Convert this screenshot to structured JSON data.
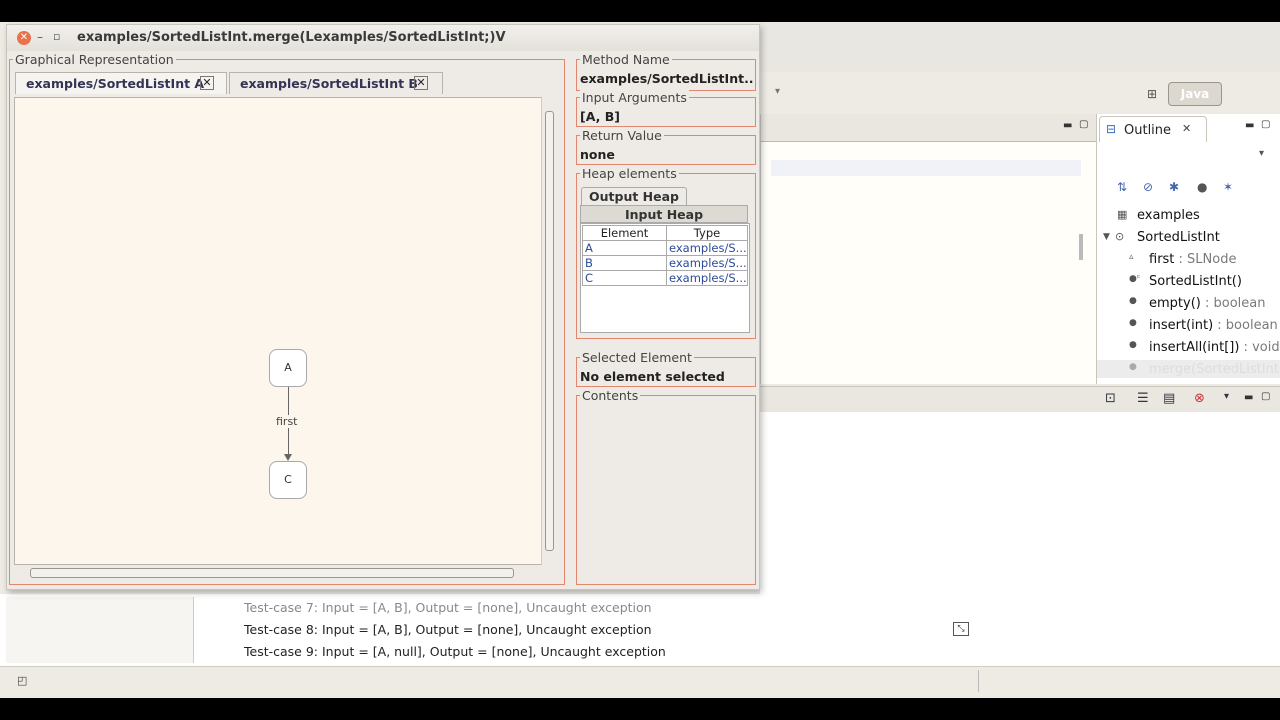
{
  "dialog": {
    "title": "examples/SortedListInt.merge(Lexamples/SortedListInt;)V",
    "graphical_label": "Graphical Representation",
    "tabs": [
      {
        "label": "examples/SortedListInt A"
      },
      {
        "label": "examples/SortedListInt B"
      }
    ],
    "close_glyph": "✕",
    "graph": {
      "nodes": [
        {
          "label": "A"
        },
        {
          "label": "C"
        }
      ],
      "edge_label": "first"
    },
    "method_name_label": "Method Name",
    "method_name_value": "examples/SortedListInt....",
    "input_args_label": "Input Arguments",
    "input_args_value": "[A, B]",
    "return_value_label": "Return Value",
    "return_value_value": "none",
    "heap_label": "Heap elements",
    "heap_tabs": {
      "output": "Output Heap",
      "input": "Input Heap"
    },
    "heap_table": {
      "headers": [
        "Element",
        "Type"
      ],
      "rows": [
        {
          "element": "A",
          "type": "examples/S..."
        },
        {
          "element": "B",
          "type": "examples/S..."
        },
        {
          "element": "C",
          "type": "examples/S..."
        }
      ]
    },
    "selected_label": "Selected Element",
    "selected_value": "No element selected",
    "contents_label": "Contents"
  },
  "ide": {
    "perspective_button": "Java",
    "outline": {
      "tab_label": "Outline",
      "items": [
        {
          "icon": "package-icon",
          "label": "examples",
          "type": ""
        },
        {
          "icon": "class-icon",
          "label": "SortedListInt",
          "type": ""
        },
        {
          "icon": "field-icon",
          "label": "first",
          "type": " : SLNode"
        },
        {
          "icon": "constructor-icon",
          "label": "SortedListInt()",
          "type": ""
        },
        {
          "icon": "method-icon",
          "label": "empty()",
          "type": " : boolean"
        },
        {
          "icon": "method-icon",
          "label": "insert(int)",
          "type": " : boolean"
        },
        {
          "icon": "method-icon",
          "label": "insertAll(int[])",
          "type": " : void"
        },
        {
          "icon": "method-icon",
          "label": "merge(SortedListInt)",
          "type": ""
        }
      ]
    },
    "test_results": [
      "Test-case 7: Input = [A, B], Output = [none], Uncaught exception",
      "Test-case 8: Input = [A, B], Output = [none], Uncaught exception",
      "Test-case 9: Input = [A, null], Output = [none], Uncaught exception"
    ]
  },
  "colors": {
    "accent_border": "#e2876f",
    "canvas_bg": "#fdf6ec",
    "link_blue": "#2b4b9a"
  }
}
